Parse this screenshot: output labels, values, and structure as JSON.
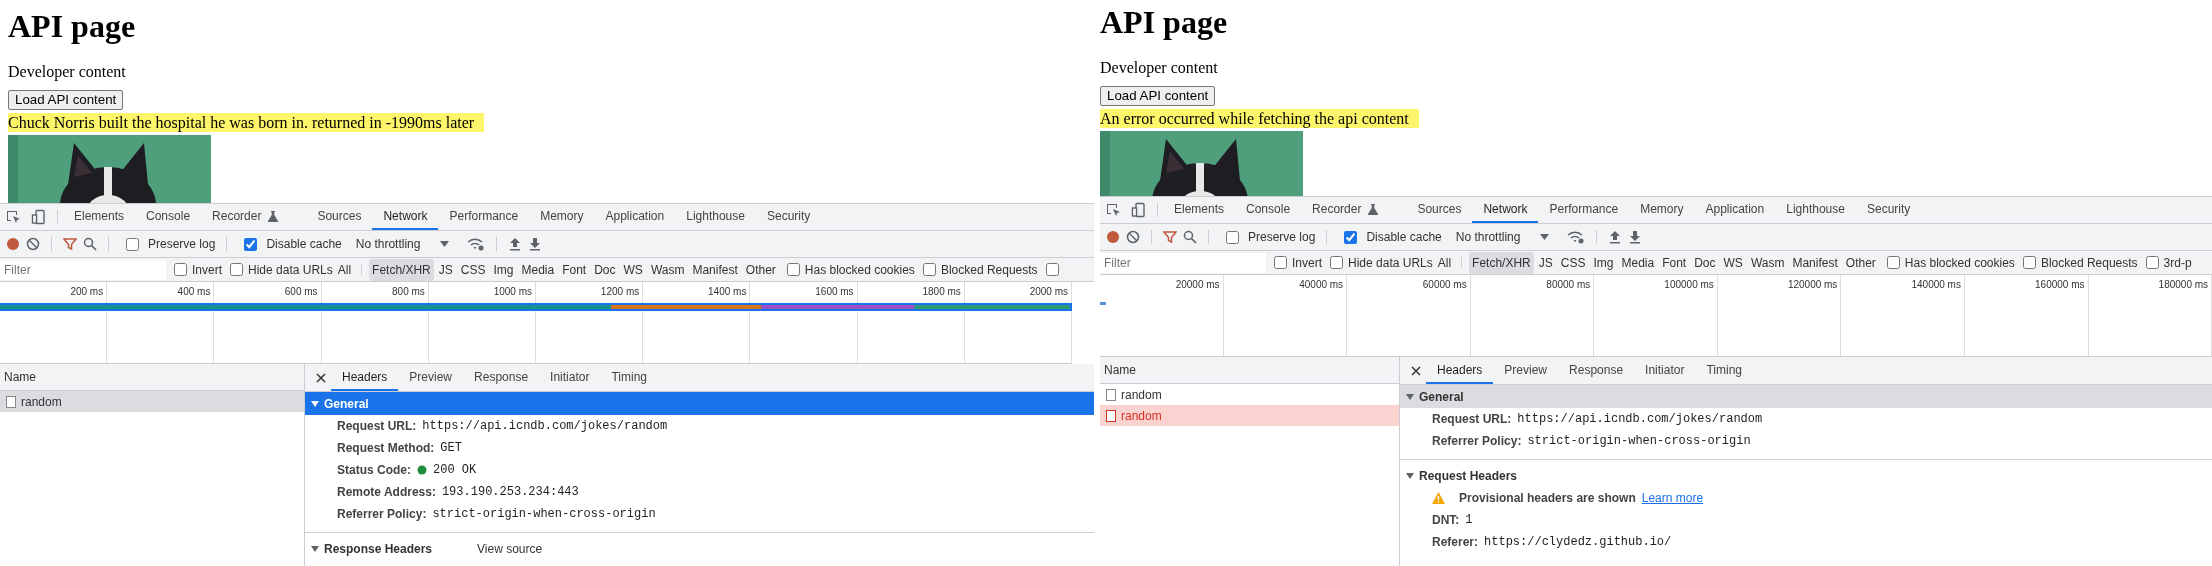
{
  "panels": [
    {
      "page": {
        "heading": "API page",
        "text": "Developer content",
        "button": "Load API content",
        "message": "Chuck Norris built the hospital he was born in. returned in -1990ms later"
      },
      "devtools": {
        "tabs": [
          {
            "label": "Elements",
            "selected": false,
            "kind": "plain"
          },
          {
            "label": "Console",
            "selected": false,
            "kind": "plain"
          },
          {
            "label": "Recorder",
            "selected": false,
            "kind": "experiment"
          },
          {
            "label": "Sources",
            "selected": false,
            "kind": "plain"
          },
          {
            "label": "Network",
            "selected": true,
            "kind": "plain"
          },
          {
            "label": "Performance",
            "selected": false,
            "kind": "plain"
          },
          {
            "label": "Memory",
            "selected": false,
            "kind": "plain"
          },
          {
            "label": "Application",
            "selected": false,
            "kind": "plain"
          },
          {
            "label": "Lighthouse",
            "selected": false,
            "kind": "plain"
          },
          {
            "label": "Security",
            "selected": false,
            "kind": "plain"
          }
        ],
        "toolbar": {
          "preserve_log": {
            "label": "Preserve log",
            "checked": false
          },
          "disable_cache": {
            "label": "Disable cache",
            "checked": true
          },
          "throttling": "No throttling"
        },
        "filter": {
          "placeholder": "Filter",
          "checks_before": [
            {
              "label": "Invert",
              "checked": false
            },
            {
              "label": "Hide data URLs",
              "checked": false
            }
          ],
          "types": [
            {
              "label": "All",
              "selected": false
            },
            {
              "label": "Fetch/XHR",
              "selected": true
            },
            {
              "label": "JS",
              "selected": false
            },
            {
              "label": "CSS",
              "selected": false
            },
            {
              "label": "Img",
              "selected": false
            },
            {
              "label": "Media",
              "selected": false
            },
            {
              "label": "Font",
              "selected": false
            },
            {
              "label": "Doc",
              "selected": false
            },
            {
              "label": "WS",
              "selected": false
            },
            {
              "label": "Wasm",
              "selected": false
            },
            {
              "label": "Manifest",
              "selected": false
            },
            {
              "label": "Other",
              "selected": false
            }
          ],
          "checks_after": [
            {
              "label": "Has blocked cookies",
              "checked": false
            },
            {
              "label": "Blocked Requests",
              "checked": false
            },
            {
              "checked": false
            }
          ]
        },
        "timeline": {
          "kind": "busy",
          "ticks": [
            "200 ms",
            "400 ms",
            "600 ms",
            "800 ms",
            "1000 ms",
            "1200 ms",
            "1400 ms",
            "1600 ms",
            "1800 ms",
            "2000 ms"
          ]
        },
        "requests": {
          "header": "Name",
          "rows": [
            {
              "name": "random",
              "selected": true,
              "failed": false
            }
          ]
        },
        "detail": {
          "tabs": [
            {
              "label": "Headers",
              "selected": true
            },
            {
              "label": "Preview",
              "selected": false
            },
            {
              "label": "Response",
              "selected": false
            },
            {
              "label": "Initiator",
              "selected": false
            },
            {
              "label": "Timing",
              "selected": false
            }
          ],
          "sections": [
            {
              "title": "General",
              "expanded": true,
              "selected": true,
              "rows": [
                {
                  "kind": "field",
                  "label": "Request URL:",
                  "value": "https://api.icndb.com/jokes/random"
                },
                {
                  "kind": "field",
                  "label": "Request Method:",
                  "value": "GET"
                },
                {
                  "kind": "status",
                  "label": "Status Code:",
                  "value": "200 OK"
                },
                {
                  "kind": "field",
                  "label": "Remote Address:",
                  "value": "193.190.253.234:443"
                },
                {
                  "kind": "field",
                  "label": "Referrer Policy:",
                  "value": "strict-origin-when-cross-origin"
                }
              ]
            },
            {
              "title": "Response Headers",
              "expanded": true,
              "selected": false,
              "action": "View source"
            }
          ],
          "focused": true
        }
      }
    },
    {
      "page": {
        "heading": "API page",
        "text": "Developer content",
        "button": "Load API content",
        "message": "An error occurred while fetching the api content"
      },
      "devtools": {
        "tabs": [
          {
            "label": "Elements",
            "selected": false,
            "kind": "plain"
          },
          {
            "label": "Console",
            "selected": false,
            "kind": "plain"
          },
          {
            "label": "Recorder",
            "selected": false,
            "kind": "experiment"
          },
          {
            "label": "Sources",
            "selected": false,
            "kind": "plain"
          },
          {
            "label": "Network",
            "selected": true,
            "kind": "plain"
          },
          {
            "label": "Performance",
            "selected": false,
            "kind": "plain"
          },
          {
            "label": "Memory",
            "selected": false,
            "kind": "plain"
          },
          {
            "label": "Application",
            "selected": false,
            "kind": "plain"
          },
          {
            "label": "Lighthouse",
            "selected": false,
            "kind": "plain"
          },
          {
            "label": "Security",
            "selected": false,
            "kind": "plain"
          }
        ],
        "toolbar": {
          "preserve_log": {
            "label": "Preserve log",
            "checked": false
          },
          "disable_cache": {
            "label": "Disable cache",
            "checked": true
          },
          "throttling": "No throttling"
        },
        "filter": {
          "placeholder": "Filter",
          "checks_before": [
            {
              "label": "Invert",
              "checked": false
            },
            {
              "label": "Hide data URLs",
              "checked": false
            }
          ],
          "types": [
            {
              "label": "All",
              "selected": false
            },
            {
              "label": "Fetch/XHR",
              "selected": true
            },
            {
              "label": "JS",
              "selected": false
            },
            {
              "label": "CSS",
              "selected": false
            },
            {
              "label": "Img",
              "selected": false
            },
            {
              "label": "Media",
              "selected": false
            },
            {
              "label": "Font",
              "selected": false
            },
            {
              "label": "Doc",
              "selected": false
            },
            {
              "label": "WS",
              "selected": false
            },
            {
              "label": "Wasm",
              "selected": false
            },
            {
              "label": "Manifest",
              "selected": false
            },
            {
              "label": "Other",
              "selected": false
            }
          ],
          "checks_after": [
            {
              "label": "Has blocked cookies",
              "checked": false
            },
            {
              "label": "Blocked Requests",
              "checked": false
            },
            {
              "label": "3rd-p",
              "checked": false
            }
          ]
        },
        "timeline": {
          "kind": "sparse",
          "ticks": [
            "20000 ms",
            "40000 ms",
            "60000 ms",
            "80000 ms",
            "100000 ms",
            "120000 ms",
            "140000 ms",
            "160000 ms",
            "180000 ms"
          ]
        },
        "requests": {
          "header": "Name",
          "rows": [
            {
              "name": "random",
              "selected": false,
              "failed": false
            },
            {
              "name": "random",
              "selected": true,
              "failed": true
            }
          ]
        },
        "detail": {
          "tabs": [
            {
              "label": "Headers",
              "selected": true
            },
            {
              "label": "Preview",
              "selected": false
            },
            {
              "label": "Response",
              "selected": false
            },
            {
              "label": "Initiator",
              "selected": false
            },
            {
              "label": "Timing",
              "selected": false
            }
          ],
          "sections": [
            {
              "title": "General",
              "expanded": true,
              "selected": true,
              "rows": [
                {
                  "kind": "field",
                  "label": "Request URL:",
                  "value": "https://api.icndb.com/jokes/random"
                },
                {
                  "kind": "field",
                  "label": "Referrer Policy:",
                  "value": "strict-origin-when-cross-origin"
                }
              ]
            },
            {
              "title": "Request Headers",
              "expanded": true,
              "selected": false,
              "rows": [
                {
                  "kind": "warning",
                  "label": "Provisional headers are shown",
                  "link": "Learn more"
                },
                {
                  "kind": "field",
                  "label": "DNT:",
                  "value": "1"
                },
                {
                  "kind": "field",
                  "label": "Referer:",
                  "value": "https://clydedz.github.io/"
                }
              ]
            }
          ],
          "focused": false
        }
      }
    }
  ]
}
